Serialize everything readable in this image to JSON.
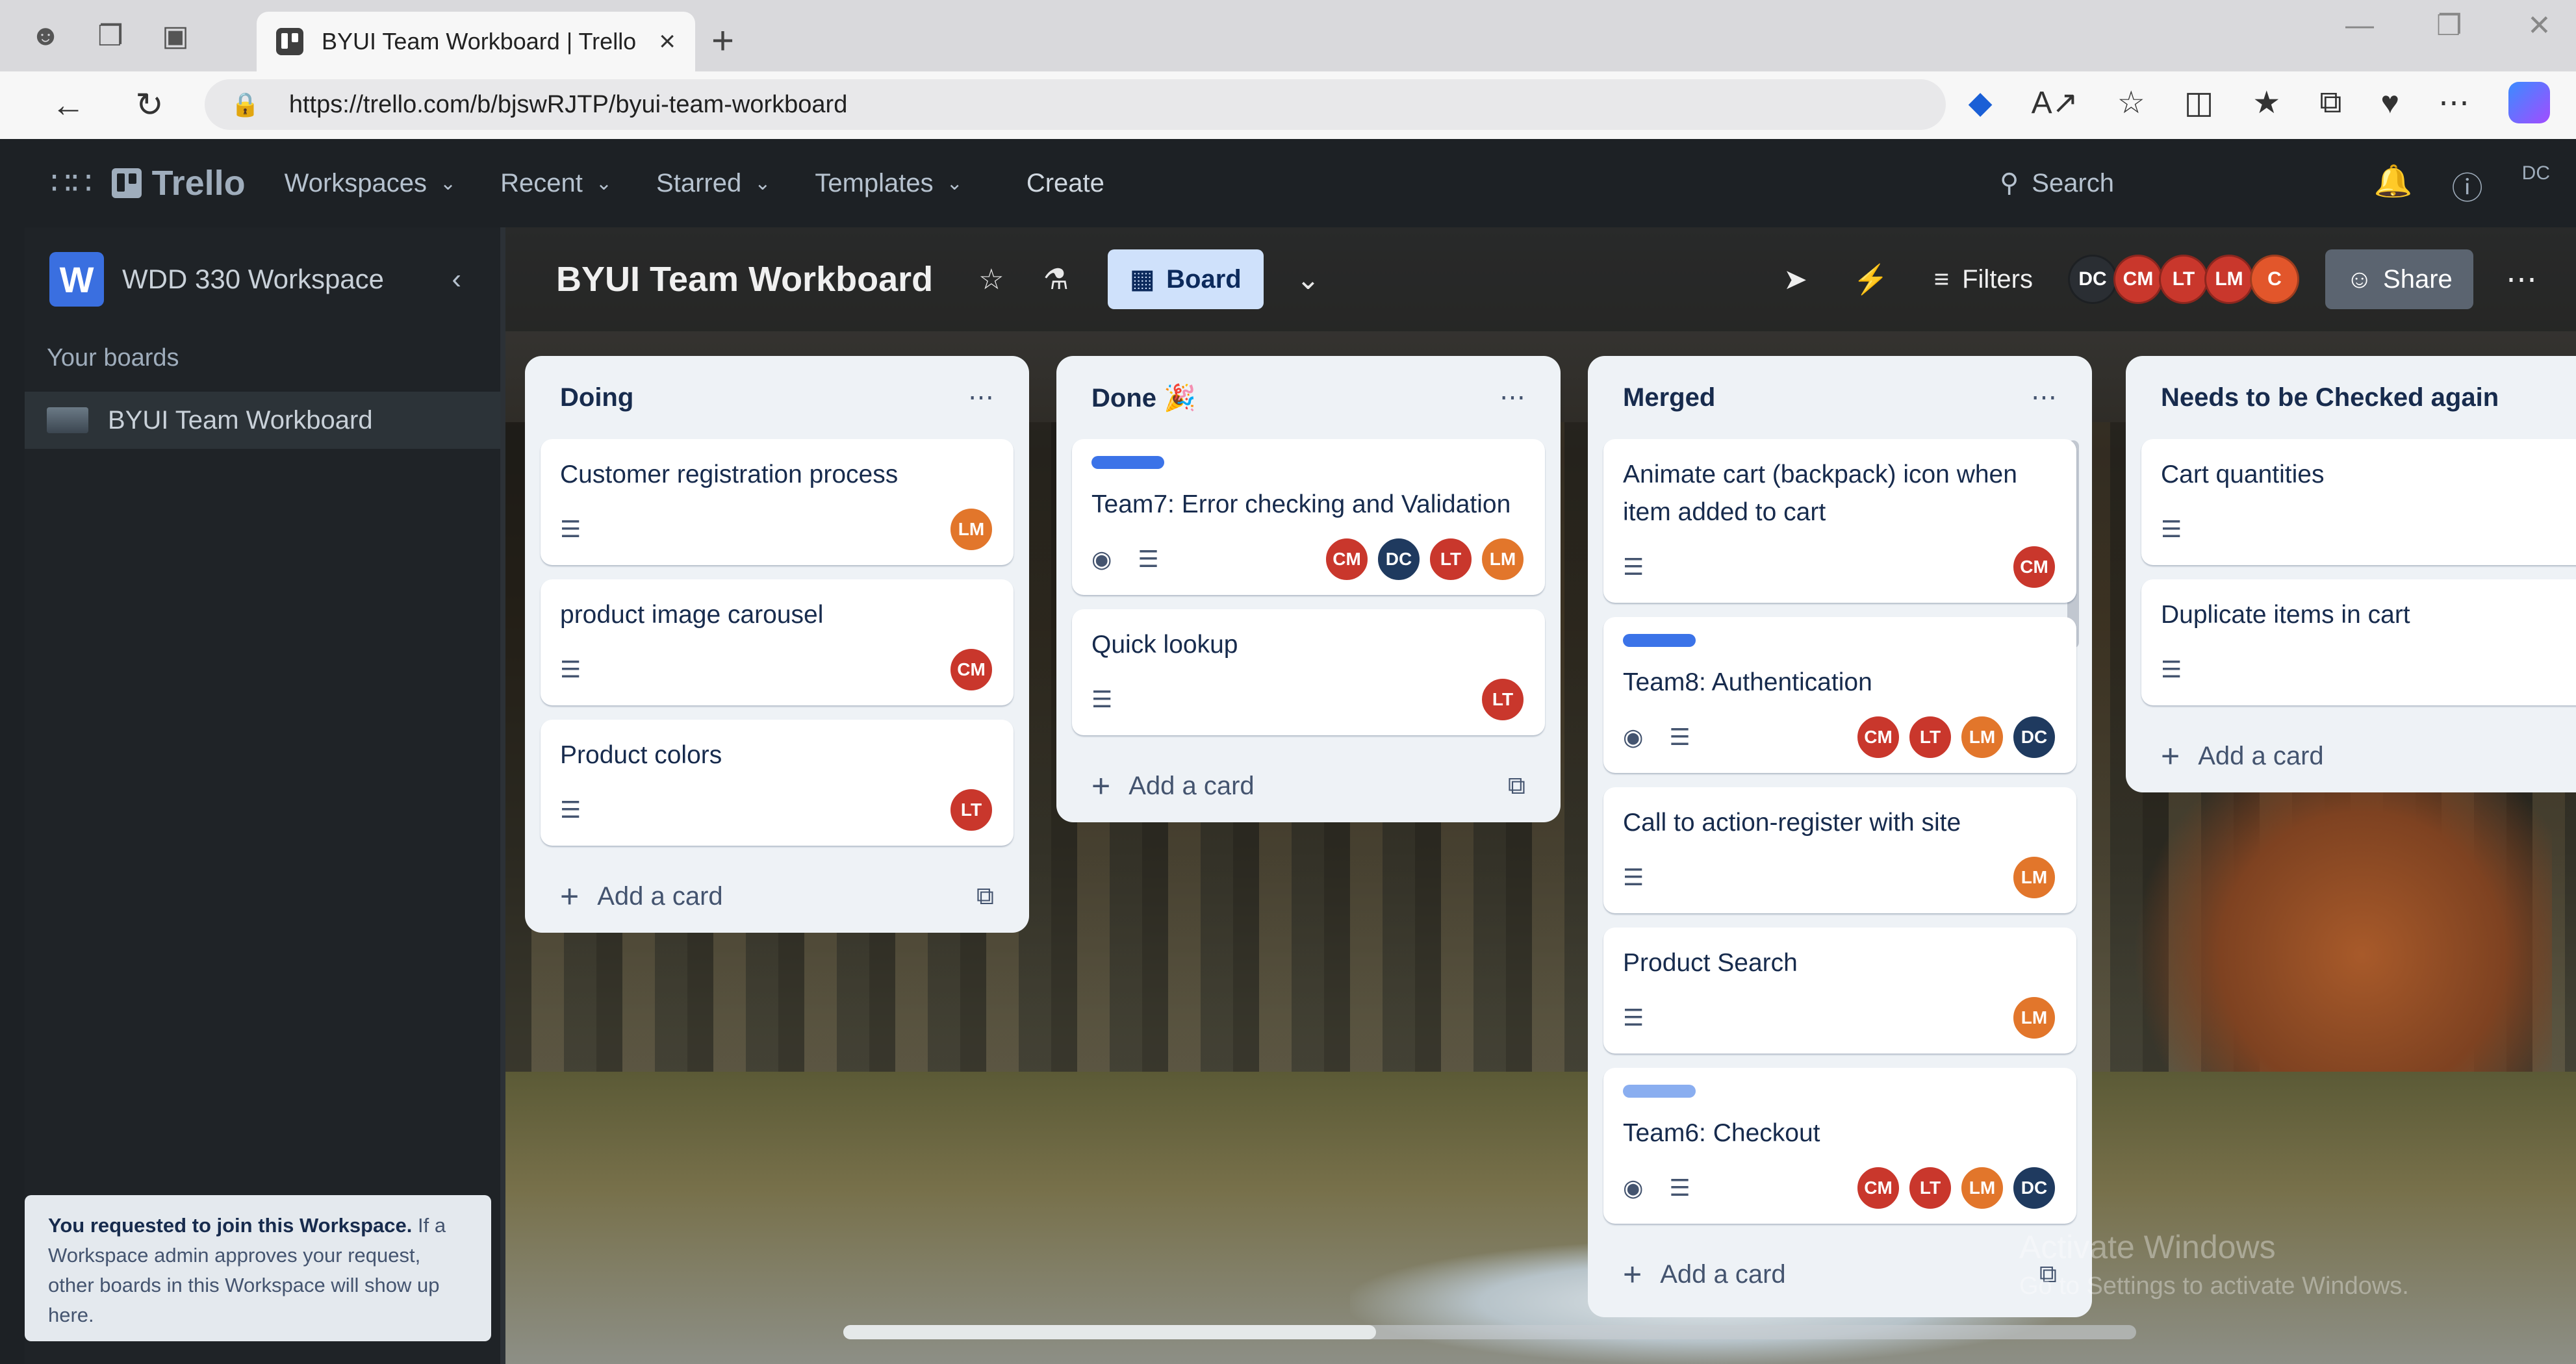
{
  "browser": {
    "tab_title": "BYUI Team Workboard | Trello",
    "url": "https://trello.com/b/bjswRJTP/byui-team-workboard"
  },
  "header": {
    "logo": "Trello",
    "nav": [
      "Workspaces",
      "Recent",
      "Starred",
      "Templates"
    ],
    "create": "Create",
    "search_placeholder": "Search",
    "user_initials": "DC"
  },
  "sidebar": {
    "workspace_badge": "W",
    "workspace_name": "WDD 330 Workspace",
    "section_label": "Your boards",
    "boards": [
      "BYUI Team Workboard"
    ],
    "join_note_bold": "You requested to join this Workspace.",
    "join_note_rest": " If a Workspace admin approves your request, other boards in this Workspace will show up here."
  },
  "board": {
    "title": "BYUI Team Workboard",
    "view": "Board",
    "filters": "Filters",
    "share": "Share",
    "members": [
      "DC",
      "CM",
      "LT",
      "LM",
      "C"
    ]
  },
  "lists": [
    {
      "title": "Doing",
      "cards": [
        {
          "title": "Customer registration process",
          "members": [
            "LM"
          ]
        },
        {
          "title": "product image carousel",
          "members": [
            "CM"
          ]
        },
        {
          "title": "Product colors",
          "members": [
            "LT"
          ]
        }
      ],
      "add": "Add a card"
    },
    {
      "title": "Done 🎉",
      "cards": [
        {
          "title": "Team7: Error checking and Validation",
          "label": true,
          "watch": true,
          "members": [
            "CM",
            "DC",
            "LT",
            "LM"
          ]
        },
        {
          "title": "Quick lookup",
          "members": [
            "LT"
          ]
        }
      ],
      "add": "Add a card"
    },
    {
      "title": "Merged",
      "cards": [
        {
          "title": "Animate cart (backpack) icon when item added to cart",
          "members": [
            "CM"
          ]
        },
        {
          "title": "Team8: Authentication",
          "label": true,
          "watch": true,
          "members": [
            "CM",
            "LT",
            "LM",
            "DC"
          ]
        },
        {
          "title": "Call to action-register with site",
          "members": [
            "LM"
          ]
        },
        {
          "title": "Product Search",
          "members": [
            "LM"
          ]
        },
        {
          "title": "Team6: Checkout",
          "label": true,
          "label_light": true,
          "watch": true,
          "members": [
            "CM",
            "LT",
            "LM",
            "DC"
          ]
        }
      ],
      "add": "Add a card"
    },
    {
      "title": "Needs to be Checked again",
      "cards": [
        {
          "title": "Cart quantities",
          "members": []
        },
        {
          "title": "Duplicate items in cart",
          "members": []
        }
      ],
      "add": "Add a card"
    }
  ],
  "watermark": {
    "line1": "Activate Windows",
    "line2": "Go to Settings to activate Windows."
  }
}
